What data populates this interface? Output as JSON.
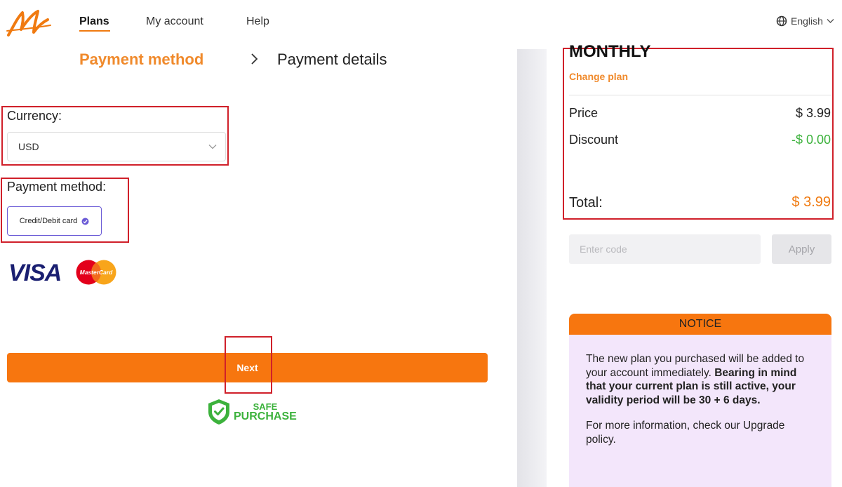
{
  "header": {
    "nav": [
      {
        "label": "Plans",
        "active": true
      },
      {
        "label": "My account",
        "active": false
      },
      {
        "label": "Help",
        "active": false
      }
    ],
    "language": "English",
    "icons": {
      "logo": "brand-m-logo",
      "language": "globe-icon",
      "dropdown": "chevron-down-icon"
    }
  },
  "steps": {
    "current": "Payment method",
    "next": "Payment details"
  },
  "form": {
    "currency_label": "Currency:",
    "currency_value": "USD",
    "payment_method_label": "Payment method:",
    "payment_option": "Credit/Debit card",
    "card_brands": {
      "visa": "VISA",
      "mastercard": "MasterCard"
    },
    "next_label": "Next",
    "safe_purchase": {
      "line1": "SAFE",
      "line2": "PURCHASE"
    }
  },
  "summary": {
    "plan": "MONTHLY",
    "change_plan": "Change plan",
    "price_label": "Price",
    "price_value": "$ 3.99",
    "discount_label": "Discount",
    "discount_value": "-$ 0.00",
    "total_label": "Total:",
    "total_value": "$ 3.99",
    "code_placeholder": "Enter code",
    "apply_label": "Apply"
  },
  "notice": {
    "title": "NOTICE",
    "text1": "The new plan you purchased will be added to your account immediately.",
    "text_bold": "Bearing in mind that your current plan is still active, your validity period will be 30 + 6 days.",
    "text2": "For more information, check our Upgrade policy."
  },
  "colors": {
    "accent": "#f7760f",
    "accent_text": "#f08a2c",
    "discount": "#3cb23c",
    "highlight_box": "#d0202a",
    "notice_bg": "#f3e6fb",
    "selected_border": "#6b5bd6"
  }
}
